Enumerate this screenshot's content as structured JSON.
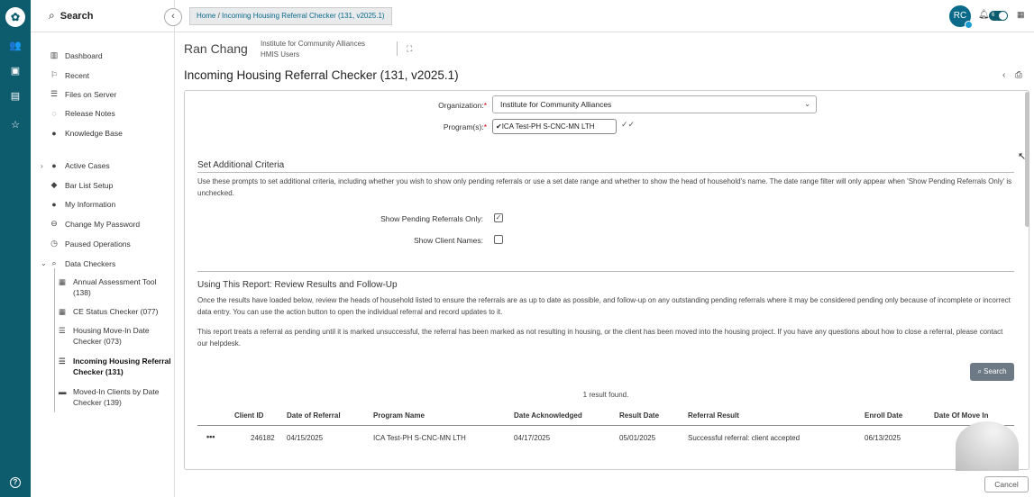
{
  "sidebar": {
    "search_label": "Search",
    "items": [
      {
        "label": "Dashboard",
        "icon": "map-icon"
      },
      {
        "label": "Recent",
        "icon": "flag-icon"
      },
      {
        "label": "Files on Server",
        "icon": "list-icon"
      },
      {
        "label": "Release Notes",
        "icon": "bulb-icon"
      },
      {
        "label": "Knowledge Base",
        "icon": "question-icon"
      },
      {
        "label": "Active Cases",
        "icon": "person-icon"
      },
      {
        "label": "Bar List Setup",
        "icon": "bell-icon"
      },
      {
        "label": "My Information",
        "icon": "person-icon"
      },
      {
        "label": "Change My Password",
        "icon": "arrow-circle-icon"
      },
      {
        "label": "Paused Operations",
        "icon": "clock-icon"
      },
      {
        "label": "Data Checkers",
        "icon": "search-icon"
      }
    ],
    "sub_items": [
      {
        "label": "Annual Assessment Tool (138)"
      },
      {
        "label": "CE Status Checker (077)"
      },
      {
        "label": "Housing Move-In Date Checker (073)"
      },
      {
        "label": "Incoming Housing Referral Checker (131)"
      },
      {
        "label": "Moved-In Clients by Date Checker (139)"
      }
    ]
  },
  "topbar": {
    "breadcrumb_home": "Home",
    "breadcrumb_sep": "/",
    "breadcrumb_current": "Incoming Housing Referral Checker (131, v2025.1)",
    "avatar_initials": "RC",
    "toggle_text": "6"
  },
  "header": {
    "user_name": "Ran Chang",
    "org_name": "Institute for Community Alliances",
    "org_group": "HMIS Users",
    "page_title": "Incoming Housing Referral Checker (131, v2025.1)"
  },
  "form": {
    "organization_label": "Organization:",
    "organization_value": "Institute for Community Alliances",
    "programs_label": "Program(s):",
    "program_chip": "ICA Test-PH S-CNC-MN LTH",
    "required_mark": "*"
  },
  "criteria": {
    "title": "Set Additional Criteria",
    "description": "Use these prompts to set additional criteria, including whether you wish to show only pending referrals or use a set date range and whether to show the head of household's name. The date range filter will only appear when 'Show Pending Referrals Only' is unchecked.",
    "pending_label": "Show Pending Referrals Only:",
    "pending_checked": true,
    "client_names_label": "Show Client Names:",
    "client_names_checked": false
  },
  "usage": {
    "title": "Using This Report: Review Results and Follow-Up",
    "para1": "Once the results have loaded below, review the heads of household listed to ensure the referrals are as up to date as possible, and follow-up on any outstanding pending referrals where it may be considered pending only because of incomplete or incorrect data entry. You can use the action button to open the individual referral and record updates to it.",
    "para2": "This report treats a referral as pending until it is marked unsuccessful, the referral has been marked as not resulting in housing, or the client has been moved into the housing project. If you have any questions about how to close a referral, please contact our helpdesk."
  },
  "results": {
    "search_button": "Search",
    "count_text": "1 result found.",
    "columns": [
      "Client ID",
      "Date of Referral",
      "Program Name",
      "Date Acknowledged",
      "Result Date",
      "Referral Result",
      "Enroll Date",
      "Date Of Move In"
    ],
    "rows": [
      {
        "action": "•••",
        "client_id": "246182",
        "date_of_referral": "04/15/2025",
        "program_name": "ICA Test-PH S-CNC-MN LTH",
        "date_acknowledged": "04/17/2025",
        "result_date": "05/01/2025",
        "referral_result": "Successful referral: client accepted",
        "enroll_date": "06/13/2025",
        "date_of_move_in": ""
      }
    ]
  },
  "footer": {
    "cancel_button": "Cancel"
  },
  "colors": {
    "rail": "#0d5c6e",
    "link": "#0a6a8a",
    "search_button": "#6d7a85"
  }
}
